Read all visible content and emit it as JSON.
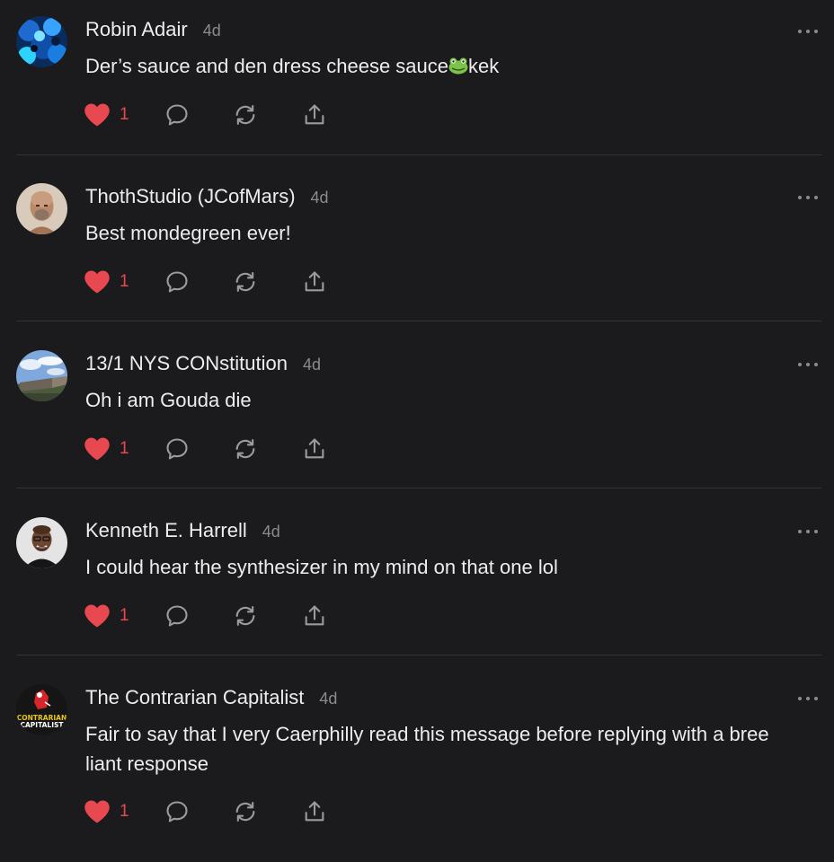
{
  "comments": [
    {
      "author": "Robin Adair",
      "time": "4d",
      "text_before_emoji": "Der’s sauce and den dress cheese sauce",
      "emoji": "frog-face-emoji",
      "text_after_emoji": "kek",
      "likes": "1"
    },
    {
      "author": "ThothStudio (JCofMars)",
      "time": "4d",
      "text": "Best mondegreen ever!",
      "likes": "1"
    },
    {
      "author": "13/1 NYS CONstitution",
      "time": "4d",
      "text": "Oh i am Gouda die",
      "likes": "1"
    },
    {
      "author": "Kenneth E. Harrell",
      "time": "4d",
      "text": "I could hear the synthesizer in my mind on that one lol",
      "likes": "1"
    },
    {
      "author": "The Contrarian Capitalist",
      "time": "4d",
      "text": "Fair to say that I very Caerphilly read this message before replying with a bree liant response",
      "likes": "1",
      "avatar_text": "CONTRARIAN CAPITALIST"
    }
  ],
  "icons": {
    "like": "heart-icon",
    "reply": "comment-bubble-icon",
    "restack": "restack-icon",
    "share": "share-icon",
    "more": "more-options-icon"
  },
  "colors": {
    "background": "#1b1b1d",
    "like": "#e8484f",
    "muted": "#8b8b8f",
    "text": "#ededed",
    "divider": "#333336"
  }
}
